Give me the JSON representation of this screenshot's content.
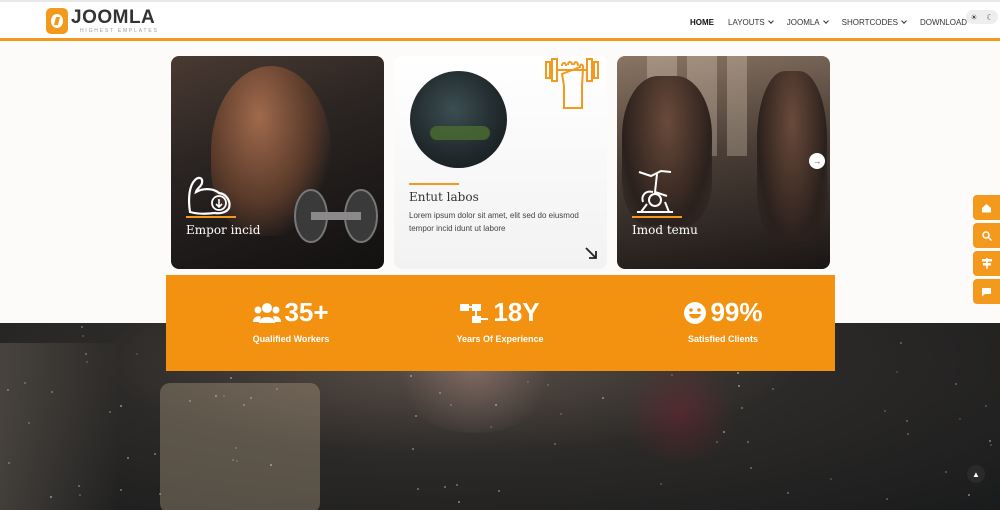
{
  "header": {
    "logo_title": "JOOMLA",
    "logo_subtitle": "HIGHEST EMPLATES",
    "nav": [
      {
        "label": "HOME",
        "active": true,
        "dropdown": false
      },
      {
        "label": "LAYOUTS",
        "active": false,
        "dropdown": true
      },
      {
        "label": "JOOMLA",
        "active": false,
        "dropdown": true
      },
      {
        "label": "SHORTCODES",
        "active": false,
        "dropdown": true
      },
      {
        "label": "DOWNLOAD",
        "active": false,
        "dropdown": false
      }
    ],
    "theme_toggle": {
      "light_icon": "☀",
      "dark_icon": "☾"
    }
  },
  "cards": [
    {
      "title": "Empor incid",
      "icon": "flexed-arm-icon"
    },
    {
      "title": "Entut labos",
      "icon": "barbell-hand-icon",
      "description": "Lorem ipsum dolor sit amet, elit sed do eiusmod tempor incid idunt ut labore",
      "arrow": "↘"
    },
    {
      "title": "Imod temu",
      "icon": "exercise-bike-icon",
      "next": "→"
    }
  ],
  "stats": [
    {
      "value": "35+",
      "label": "Qualified Workers",
      "icon": "users-icon"
    },
    {
      "value": "18Y",
      "label": "Years Of Experience",
      "icon": "sitemap-icon"
    },
    {
      "value": "99%",
      "label": "Satisfied Clients",
      "icon": "smile-icon"
    }
  ],
  "side_buttons": [
    "home-icon",
    "search-icon",
    "signpost-icon",
    "chat-icon"
  ],
  "to_top": "▲",
  "colors": {
    "accent": "#f39a1e",
    "stats_bg": "#f39111",
    "hero_dark": "#1a1b1c"
  }
}
